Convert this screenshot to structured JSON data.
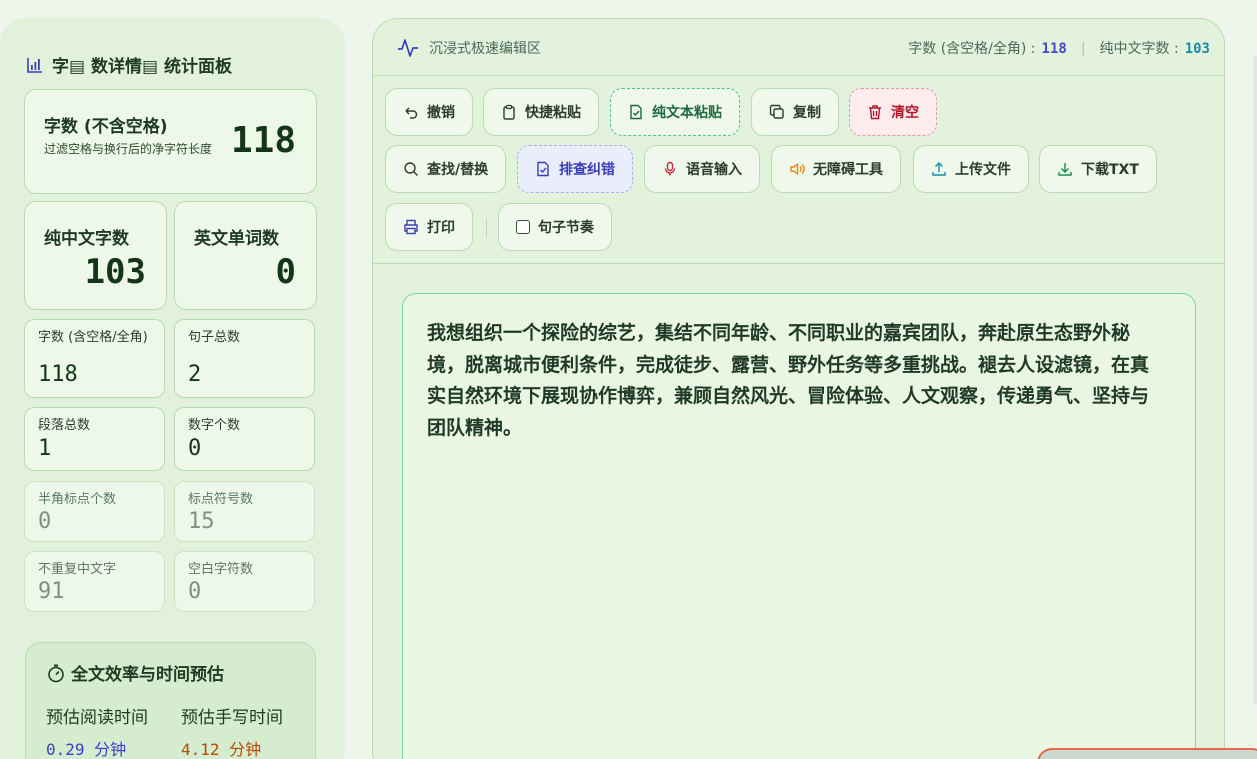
{
  "left": {
    "title": "字▤ 数详情▤ 统计面板",
    "total": {
      "label": "字数 (不含空格)",
      "sub": "过滤空格与换行后的净字符长度",
      "value": "118"
    },
    "chinese": {
      "label": "纯中文字数",
      "value": "103"
    },
    "english": {
      "label": "英文单词数",
      "value": "0"
    },
    "cards": [
      {
        "label": "字数 (含空格/全角)",
        "value": "118"
      },
      {
        "label": "句子总数",
        "value": "2"
      },
      {
        "label": "段落总数",
        "value": "1"
      },
      {
        "label": "数字个数",
        "value": "0"
      },
      {
        "label": "半角标点个数",
        "value": "0"
      },
      {
        "label": "标点符号数",
        "value": "15"
      },
      {
        "label": "不重复中文字",
        "value": "91"
      },
      {
        "label": "空白字符数",
        "value": "0"
      }
    ],
    "efficiency": {
      "title": "全文效率与时间预估",
      "read_label": "预估阅读时间",
      "write_label": "预估手写时间",
      "read_value": "0.29",
      "write_value": "4.12",
      "unit": "分钟"
    }
  },
  "editor": {
    "mode_label": "沉浸式极速编辑区",
    "stats_label_1": "字数 (含空格/全角) :",
    "stats_value_1": "118",
    "stats_sep": "|",
    "stats_label_2": "纯中文字数 :",
    "stats_value_2": "103",
    "toolbar": {
      "undo": "撤销",
      "quick_paste": "快捷粘贴",
      "plain_paste": "纯文本粘贴",
      "copy": "复制",
      "clear": "清空",
      "find_replace": "查找/替换",
      "proofread": "排查纠错",
      "voice_input": "语音输入",
      "accessibility": "无障碍工具",
      "upload": "上传文件",
      "download": "下载TXT",
      "print": "打印",
      "sentence_rhythm": "句子节奏"
    },
    "content": "我想组织一个探险的综艺，集结不同年龄、不同职业的嘉宾团队，奔赴原生态野外秘境，脱离城市便利条件，完成徒步、露营、野外任务等多重挑战。褪去人设滤镜，在真实自然环境下展现协作博弈，兼顾自然风光、冒险体验、人文观察，传递勇气、坚持与团队精神。"
  }
}
